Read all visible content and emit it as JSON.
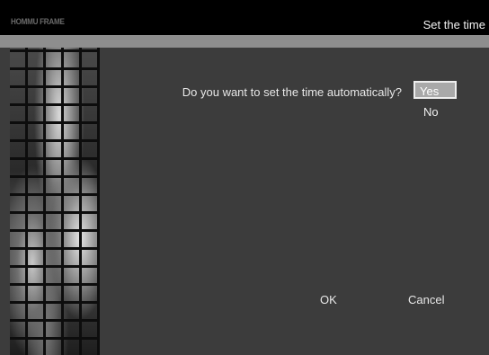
{
  "header": {
    "brand": "HOMMU FRAME",
    "title": "Set the time"
  },
  "dialog": {
    "question": "Do you want to set the time automatically?",
    "options": [
      {
        "label": "Yes",
        "selected": true
      },
      {
        "label": "No",
        "selected": false
      }
    ]
  },
  "footer": {
    "ok_label": "OK",
    "cancel_label": "Cancel"
  },
  "colors": {
    "background": "#3c3c3c",
    "header": "#000000",
    "subbar": "#8e8e8e",
    "selected_option": "#a9a9a9"
  }
}
